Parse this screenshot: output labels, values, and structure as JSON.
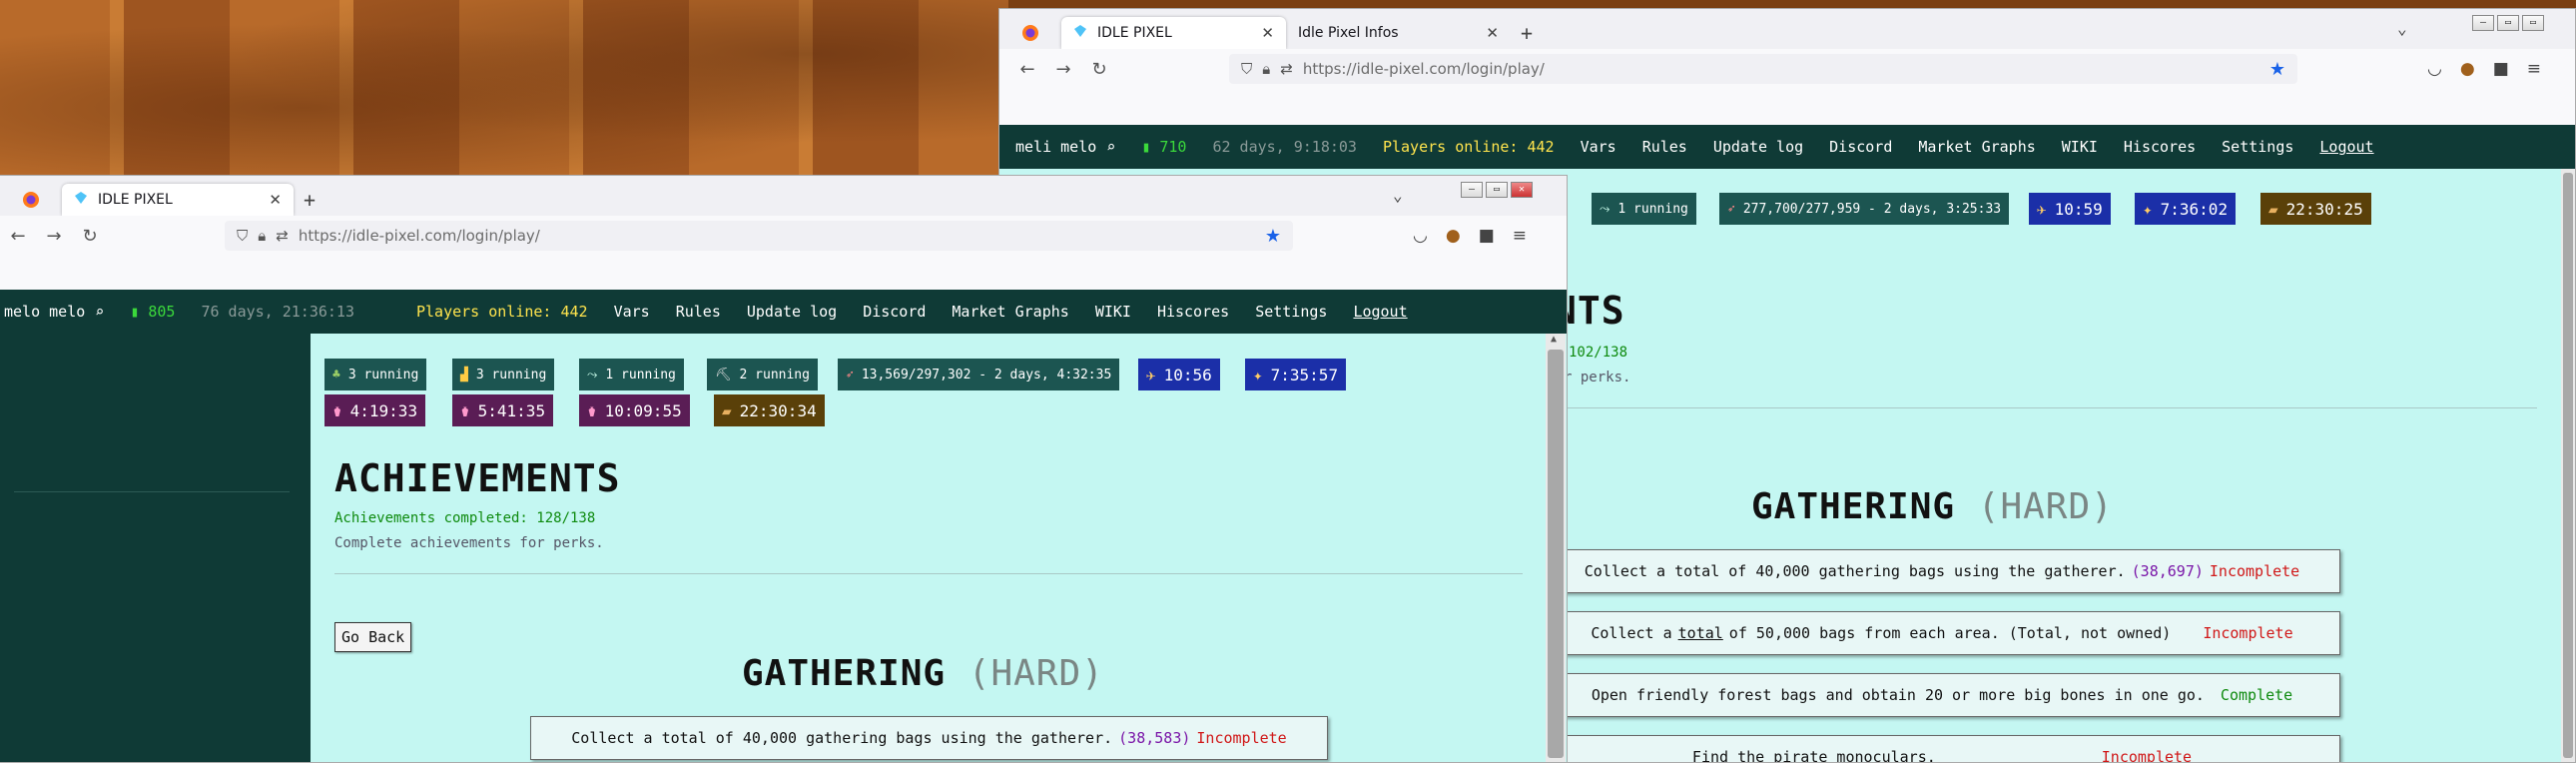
{
  "back": {
    "tabs": [
      {
        "label": "IDLE PIXEL",
        "active": true
      },
      {
        "label": "Idle Pixel Infos",
        "active": false
      }
    ],
    "url": "https://idle-pixel.com/login/play/",
    "game": {
      "username": "meli melo",
      "signal": "710",
      "time": "62 days, 9:18:03",
      "players_online": "Players online: 442",
      "nav": [
        "Vars",
        "Rules",
        "Update log",
        "Discord",
        "Market Graphs",
        "WIKI",
        "Hiscores",
        "Settings",
        "Logout"
      ]
    },
    "chips": [
      {
        "text": "",
        "kind": "teal"
      },
      {
        "text": "1 running",
        "kind": "teal"
      },
      {
        "text": "277,700/277,959 - 2 days, 3:25:33",
        "kind": "teal"
      },
      {
        "text": "10:59",
        "kind": "blue"
      },
      {
        "text": "7:36:02",
        "kind": "blue"
      },
      {
        "text": "22:30:25",
        "kind": "brown"
      }
    ],
    "title_frag": "NTS",
    "completed_frag": "102/138",
    "perks_frag": "r perks.",
    "category": {
      "name": "GATHERING",
      "level": "(HARD)"
    },
    "achievements": [
      {
        "text": "Collect a total of 40,000 gathering bags using the gatherer.",
        "progress": "(38,697)",
        "status": "Incomplete",
        "done": false
      },
      {
        "pre": "Collect a",
        "link": "total",
        "post": "of 50,000 bags from each area. (Total, not owned)",
        "status": "Incomplete",
        "done": false
      },
      {
        "text": "Open friendly forest bags and obtain 20 or more big bones in one go.",
        "status": "Complete",
        "done": true
      },
      {
        "text": "Find the pirate monoculars.",
        "status": "Incomplete",
        "done": false
      }
    ]
  },
  "front": {
    "tab": "IDLE PIXEL",
    "url": "https://idle-pixel.com/login/play/",
    "game": {
      "username": "melo melo",
      "signal": "805",
      "time": "76 days, 21:36:13",
      "players_online": "Players online: 442",
      "nav": [
        "Vars",
        "Rules",
        "Update log",
        "Discord",
        "Market Graphs",
        "WIKI",
        "Hiscores",
        "Settings",
        "Logout"
      ]
    },
    "chips_row1": [
      {
        "text": "3 running",
        "kind": "teal"
      },
      {
        "text": "3 running",
        "kind": "teal"
      },
      {
        "text": "1 running",
        "kind": "teal"
      },
      {
        "text": "2 running",
        "kind": "teal"
      },
      {
        "text": "13,569/297,302 - 2 days, 4:32:35",
        "kind": "teal"
      },
      {
        "text": "10:56",
        "kind": "blue"
      },
      {
        "text": "7:35:57",
        "kind": "blue"
      }
    ],
    "chips_row2": [
      {
        "text": "4:19:33",
        "kind": "purple"
      },
      {
        "text": "5:41:35",
        "kind": "purple"
      },
      {
        "text": "10:09:55",
        "kind": "purple"
      },
      {
        "text": "22:30:34",
        "kind": "brown"
      }
    ],
    "title": "ACHIEVEMENTS",
    "completed": "Achievements completed: 128/138",
    "perks": "Complete achievements for perks.",
    "go_back": "Go Back",
    "category": {
      "name": "GATHERING",
      "level": "(HARD)"
    },
    "achievement": {
      "text": "Collect a total of 40,000 gathering bags using the gatherer.",
      "progress": "(38,583)",
      "status": "Incomplete"
    }
  },
  "colors": {
    "game_bar": "#0f3a36",
    "content": "#c4f7f2",
    "incomplete": "#d01818",
    "complete": "#0e8a0e",
    "blue_chip": "#1b2fa8",
    "purple_chip": "#5a1d55",
    "brown_chip": "#5a4009"
  }
}
